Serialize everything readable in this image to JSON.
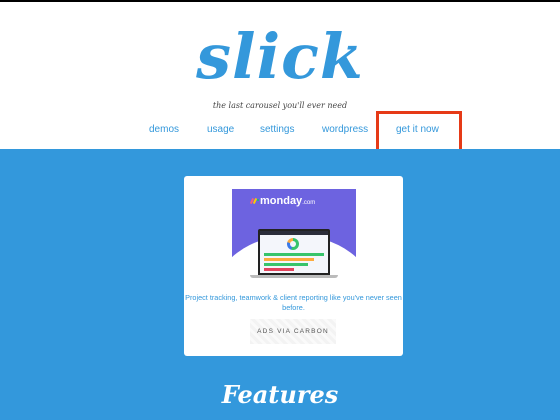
{
  "header": {
    "logo_text": "slick",
    "tagline": "the last carousel you'll ever need"
  },
  "nav": {
    "items": [
      {
        "label": "demos"
      },
      {
        "label": "usage"
      },
      {
        "label": "settings"
      },
      {
        "label": "wordpress"
      },
      {
        "label": "get it now"
      }
    ]
  },
  "ad": {
    "brand": "monday",
    "brand_tld": ".com",
    "description": "Project tracking, teamwork & client reporting like you've never seen before.",
    "carbon_label": "ADS VIA CARBON"
  },
  "section": {
    "title": "Features"
  },
  "colors": {
    "accent": "#3498db",
    "highlight": "#e63a17",
    "ad_bg": "#6d63e0"
  }
}
